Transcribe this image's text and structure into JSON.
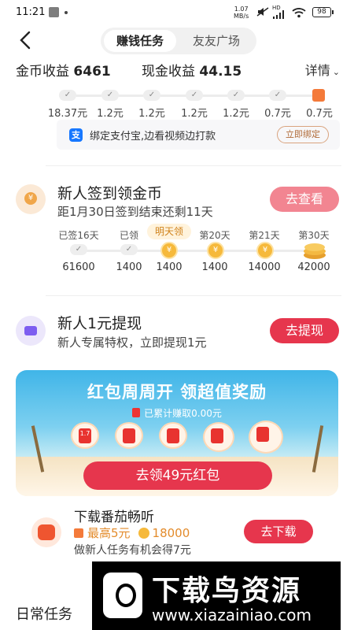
{
  "status_bar": {
    "time": "11:21",
    "speed_top": "1.07",
    "speed_unit": "MB/s",
    "network": "HD",
    "battery": "98"
  },
  "header": {
    "tabs": [
      {
        "label": "赚钱任务"
      },
      {
        "label": "友友广场"
      }
    ]
  },
  "earnings": {
    "coin_label": "金币收益",
    "coin_value": "6461",
    "cash_label": "现金收益",
    "cash_value": "44.15",
    "detail_label": "详情"
  },
  "top_track": {
    "values": [
      "18.37元",
      "1.2元",
      "1.2元",
      "1.2元",
      "1.2元",
      "0.7元",
      "0.7元"
    ]
  },
  "alipay": {
    "text": "绑定支付宝,边看视频边打款",
    "button": "立即绑定"
  },
  "signin": {
    "title": "新人签到领金币",
    "subtitle": "距1月30日签到结束还剩11天",
    "button": "去查看",
    "days": [
      "已签16天",
      "已领",
      "明天领",
      "第20天",
      "第21天",
      "第30天"
    ],
    "rewards": [
      "61600",
      "1400",
      "1400",
      "1400",
      "14000",
      "42000"
    ]
  },
  "withdraw": {
    "title": "新人1元提现",
    "subtitle": "新人专属特权，立即提现1元",
    "button": "去提现"
  },
  "banner": {
    "title": "红包周周开 领超值奖励",
    "earned": "已累计赚取0.00元",
    "first_badge": "1.7",
    "button": "去领49元红包"
  },
  "download": {
    "title": "下载番茄畅听",
    "max_reward": "最高5元",
    "coins": "18000",
    "subtitle": "做新人任务有机会得7元",
    "button": "去下载"
  },
  "daily": {
    "title": "日常任务"
  },
  "watermark": {
    "main": "下载鸟资源",
    "url": "www.xiazainiao.com"
  }
}
